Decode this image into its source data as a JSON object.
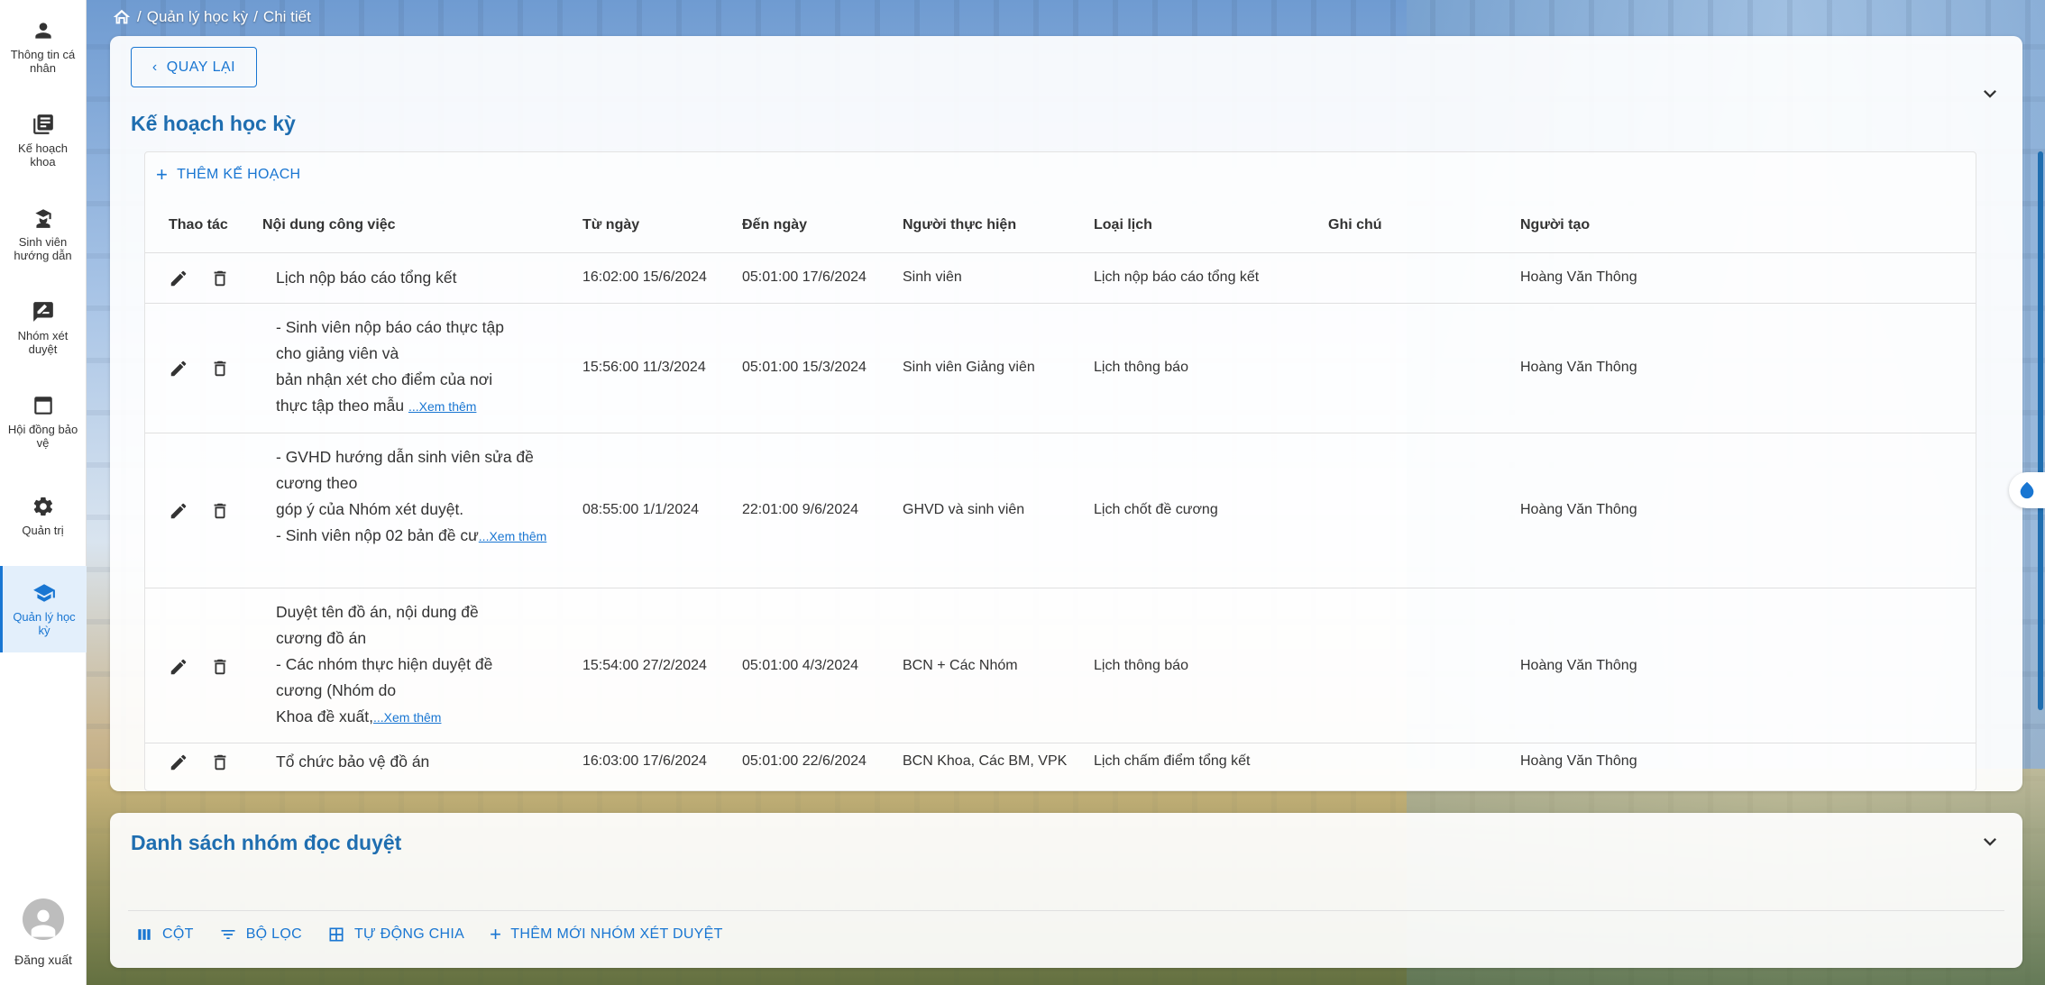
{
  "sidebar": {
    "items": [
      {
        "label": "Thông tin cá nhân",
        "icon": "person-icon"
      },
      {
        "label": "Kế hoạch khoa",
        "icon": "newspaper-icon"
      },
      {
        "label": "Sinh viên hướng dẫn",
        "icon": "student-icon"
      },
      {
        "label": "Nhóm xét duyệt",
        "icon": "rate-review-icon"
      },
      {
        "label": "Hội đồng bảo vệ",
        "icon": "window-icon"
      },
      {
        "label": "Quản trị",
        "icon": "gear-icon"
      },
      {
        "label": "Quản lý học kỳ",
        "icon": "school-icon",
        "active": true
      }
    ],
    "logout_label": "Đăng xuất"
  },
  "breadcrumb": {
    "items": [
      "Quản lý học kỳ",
      "Chi tiết"
    ]
  },
  "plan_card": {
    "back_label": "QUAY LẠI",
    "title": "Kế hoạch học kỳ",
    "add_label": "THÊM KẾ HOẠCH",
    "columns": [
      "Thao tác",
      "Nội dung công việc",
      "Từ ngày",
      "Đến ngày",
      "Người thực hiện",
      "Loại lịch",
      "Ghi chú",
      "Người tạo"
    ],
    "rows": [
      {
        "content_lines": [
          "Lịch nộp báo cáo tổng kết"
        ],
        "more": "",
        "from": "16:02:00 15/6/2024",
        "to": "05:01:00 17/6/2024",
        "performer": "Sinh viên",
        "type": "Lịch nộp báo cáo tổng kết",
        "note": "",
        "creator": "Hoàng Văn Thông"
      },
      {
        "content_lines": [
          "- Sinh viên nộp báo cáo thực tập",
          "cho giảng viên và",
          "bản nhận xét cho điểm của nơi",
          "thực tập theo mẫu"
        ],
        "more": "...Xem thêm",
        "from": "15:56:00 11/3/2024",
        "to": "05:01:00 15/3/2024",
        "performer": "Sinh viên Giảng viên",
        "type": "Lịch thông báo",
        "note": "",
        "creator": "Hoàng Văn Thông"
      },
      {
        "content_lines": [
          "- GVHD hướng dẫn sinh viên sửa đề",
          "cương theo",
          "góp ý của Nhóm xét duyệt.",
          "- Sinh viên nộp 02 bản đề cư"
        ],
        "more": "...Xem thêm",
        "from": "08:55:00 1/1/2024",
        "to": "22:01:00 9/6/2024",
        "performer": "GHVD và sinh viên",
        "type": "Lịch chốt đề cương",
        "note": "",
        "creator": "Hoàng Văn Thông"
      },
      {
        "content_lines": [
          "Duyệt tên đồ án, nội dung đề",
          "cương đồ án",
          "- Các nhóm thực hiện duyệt đề",
          "cương (Nhóm do",
          "Khoa đề xuất,"
        ],
        "more": "...Xem thêm",
        "from": "15:54:00 27/2/2024",
        "to": "05:01:00 4/3/2024",
        "performer": "BCN + Các Nhóm",
        "type": "Lịch thông báo",
        "note": "",
        "creator": "Hoàng Văn Thông"
      },
      {
        "content_lines": [
          "Tổ chức bảo vệ đồ án"
        ],
        "more": "",
        "from": "16:03:00 17/6/2024",
        "to": "05:01:00 22/6/2024",
        "performer": "BCN Khoa, Các BM, VPK",
        "type": "Lịch chấm điểm tổng kết",
        "note": "",
        "creator": "Hoàng Văn Thông"
      }
    ]
  },
  "review_card": {
    "title": "Danh sách nhóm đọc duyệt",
    "toolbar": {
      "columns_label": "CỘT",
      "filter_label": "BỘ LỌC",
      "auto_label": "TỰ ĐỘNG CHIA",
      "add_label": "THÊM MỚI NHÓM XÉT DUYỆT"
    }
  },
  "colors": {
    "accent": "#1976d2",
    "title": "#1f6eb0"
  }
}
